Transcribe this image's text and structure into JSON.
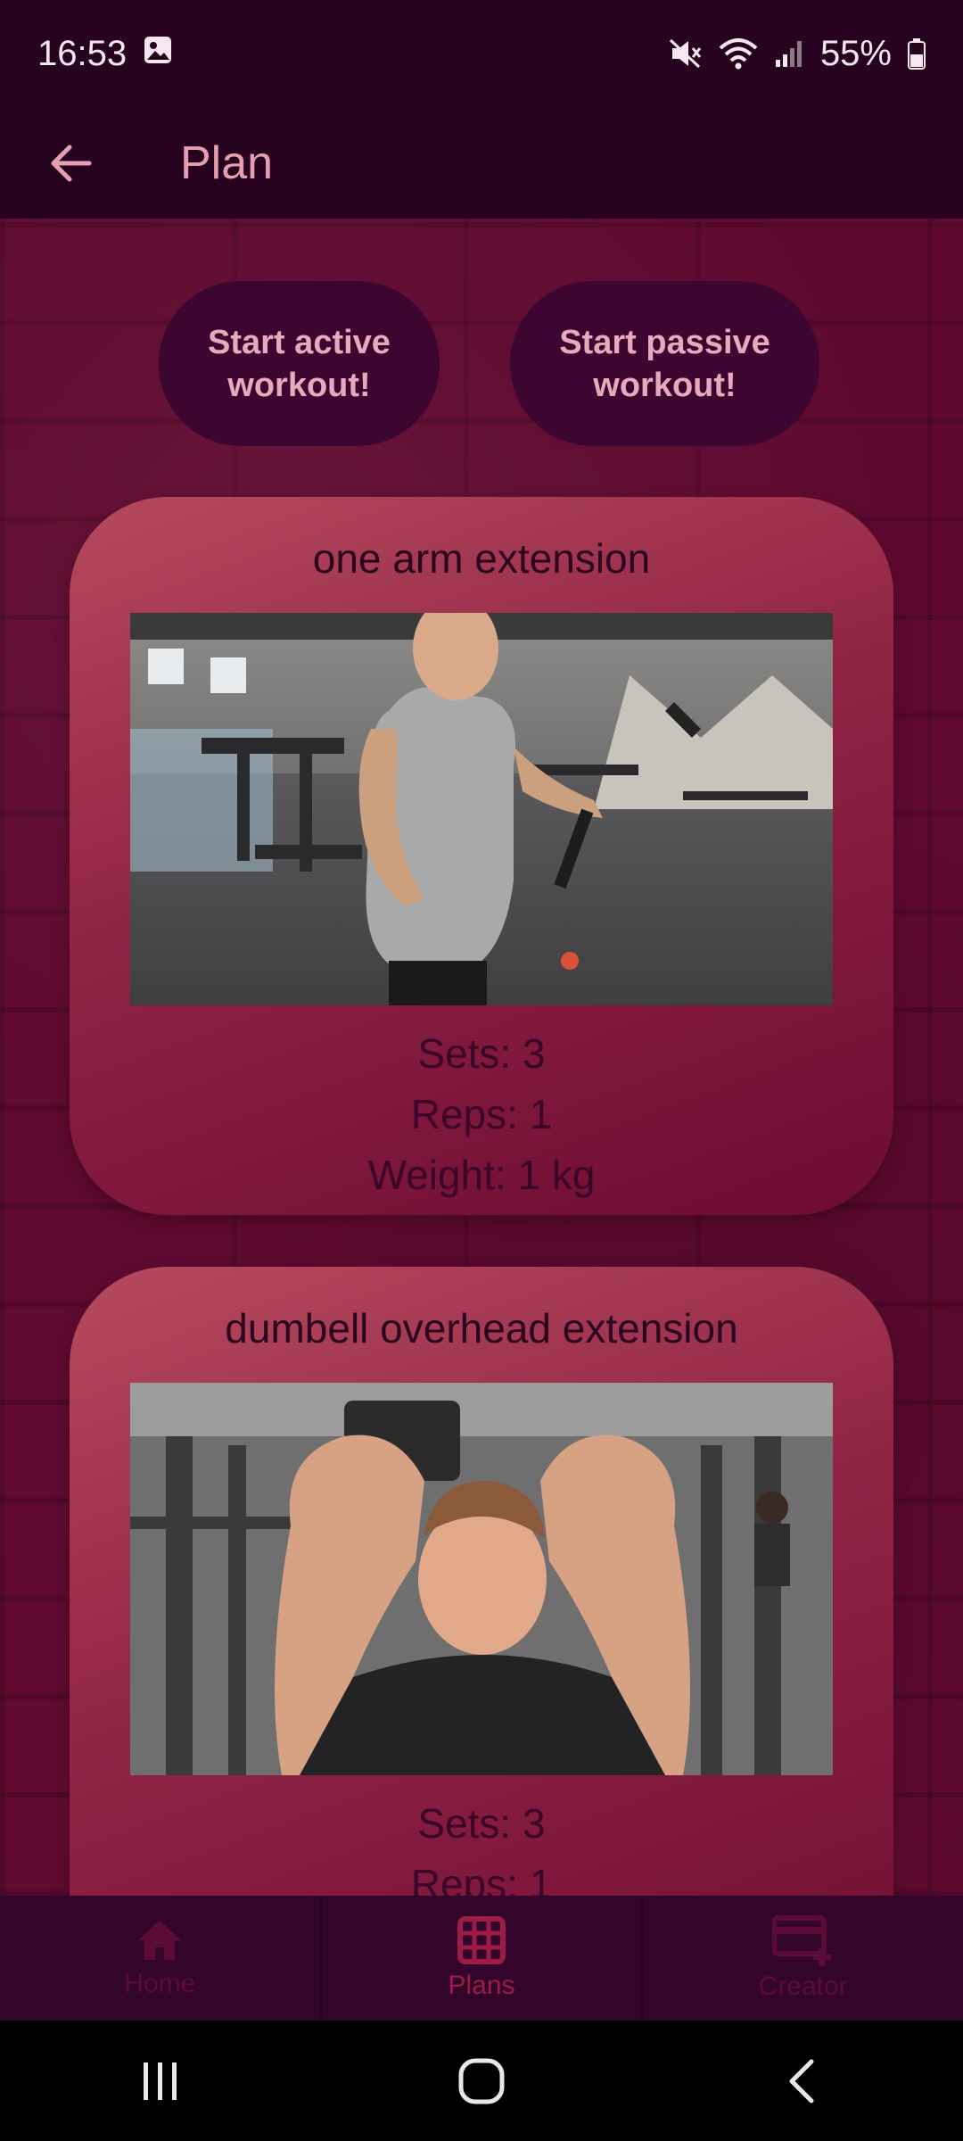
{
  "status_bar": {
    "time": "16:53",
    "battery": "55%",
    "icons": [
      "gallery-icon",
      "mute-icon",
      "wifi-icon",
      "signal-icon",
      "battery-icon"
    ]
  },
  "app_bar": {
    "title": "Plan",
    "back_icon": "arrow-left-icon"
  },
  "workout_buttons": {
    "active": "Start active workout!",
    "passive": "Start passive workout!"
  },
  "exercises": [
    {
      "name": "one arm extension",
      "sets": "Sets: 3",
      "reps": "Reps: 1",
      "weight": "Weight: 1 kg"
    },
    {
      "name": "dumbell overhead extension",
      "sets": "Sets: 3",
      "reps": "Reps: 1"
    }
  ],
  "bottom_nav": {
    "items": [
      {
        "label": "Home",
        "icon": "home-icon"
      },
      {
        "label": "Plans",
        "icon": "grid-icon",
        "selected": true
      },
      {
        "label": "Creator",
        "icon": "card-plus-icon"
      }
    ]
  },
  "colors": {
    "status_bar_bg": "#28031f",
    "title_color": "#e59fb2",
    "button_bg": "#3d0630",
    "button_text": "#e9a9bd",
    "card_gradient_start": "#b54a5e",
    "card_gradient_end": "#6d0b32",
    "nav_bg": "#33052a",
    "nav_selected": "#9b1c47",
    "nav_unselected": "#5c0b36"
  }
}
